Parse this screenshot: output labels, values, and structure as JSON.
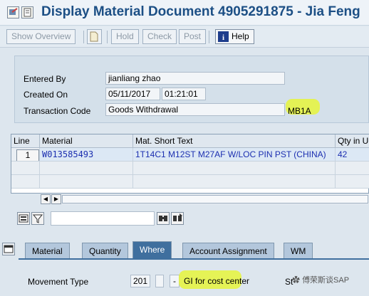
{
  "window": {
    "title": "Display Material Document 4905291875 - Jia Feng"
  },
  "toolbar": {
    "show_overview": "Show Overview",
    "hold": "Hold",
    "check": "Check",
    "post": "Post",
    "help": "Help"
  },
  "header": {
    "entered_by_label": "Entered By",
    "entered_by_value": "jianliang zhao",
    "created_on_label": "Created On",
    "created_on_date": "05/11/2017",
    "created_on_time": "01:21:01",
    "transaction_code_label": "Transaction Code",
    "transaction_code_value": "Goods Withdrawal",
    "transaction_code_id": "MB1A"
  },
  "items_table": {
    "columns": [
      "Line",
      "Material",
      "Mat. Short Text",
      "Qty in U"
    ],
    "rows": [
      {
        "line": "1",
        "material": "W013585493",
        "short_text": "1T14C1 M12ST M27AF W/LOC PIN PST (CHINA)",
        "qty": "42"
      }
    ]
  },
  "tabs": [
    "Material",
    "Quantity",
    "Where",
    "Account Assignment",
    "WM"
  ],
  "tab_selected": "Where",
  "where_tab": {
    "movement_type_label": "Movement Type",
    "movement_type_value": "201",
    "movement_type_dash": "-",
    "movement_type_desc": "GI for cost center",
    "stock_label": "St"
  },
  "watermark": "傅荣斯谈SAP",
  "colors": {
    "title": "#1c4f85",
    "tab_selected": "#3f6f9e",
    "highlight": "#e6f53b",
    "table_text": "#1c2fb0"
  }
}
